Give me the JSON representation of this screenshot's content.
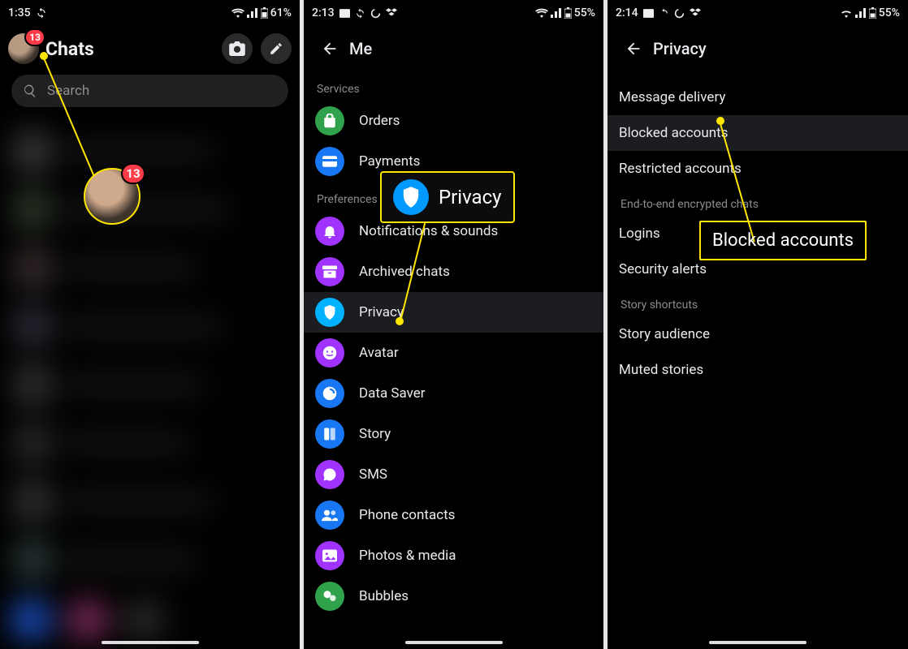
{
  "screen1": {
    "status": {
      "time": "1:35",
      "battery": "61%",
      "icons_left": [
        "sync-icon"
      ],
      "icons_right": [
        "wifi-icon",
        "signal-icon",
        "battery-icon"
      ]
    },
    "title": "Chats",
    "avatar_badge": "13",
    "big_avatar_badge": "13",
    "search_placeholder": "Search"
  },
  "screen2": {
    "status": {
      "time": "2:13",
      "battery": "55%",
      "icons_left": [
        "card-icon",
        "sync-icon",
        "spin-icon",
        "dropbox-icon"
      ]
    },
    "title": "Me",
    "sections": [
      {
        "header": "Services",
        "items": [
          {
            "icon": "bag-icon",
            "color": "c-green",
            "label": "Orders"
          },
          {
            "icon": "card-icon",
            "color": "c-blue",
            "label": "Payments"
          }
        ]
      },
      {
        "header": "Preferences",
        "items": [
          {
            "icon": "bell-icon",
            "color": "c-purp",
            "label": "Notifications & sounds"
          },
          {
            "icon": "archive-icon",
            "color": "c-purp",
            "label": "Archived chats"
          },
          {
            "icon": "shield-icon",
            "color": "c-teal",
            "label": "Privacy",
            "selected": true
          },
          {
            "icon": "face-icon",
            "color": "c-purp",
            "label": "Avatar"
          },
          {
            "icon": "data-icon",
            "color": "c-blue",
            "label": "Data Saver"
          },
          {
            "icon": "story-icon",
            "color": "c-blue",
            "label": "Story"
          },
          {
            "icon": "sms-icon",
            "color": "c-purp",
            "label": "SMS"
          },
          {
            "icon": "contacts-icon",
            "color": "c-blue",
            "label": "Phone contacts"
          },
          {
            "icon": "photos-icon",
            "color": "c-purp",
            "label": "Photos & media"
          },
          {
            "icon": "bubbles-icon",
            "color": "c-green",
            "label": "Bubbles"
          }
        ]
      }
    ],
    "callout_label": "Privacy"
  },
  "screen3": {
    "status": {
      "time": "2:14",
      "battery": "55%",
      "icons_left": [
        "card-icon",
        "sync-icon",
        "spin-icon",
        "dropbox-icon"
      ]
    },
    "title": "Privacy",
    "groups": [
      {
        "header": null,
        "items": [
          {
            "label": "Message delivery"
          },
          {
            "label": "Blocked accounts",
            "selected": true
          },
          {
            "label": "Restricted accounts"
          }
        ]
      },
      {
        "header": "End-to-end encrypted chats",
        "items": [
          {
            "label": "Logins"
          },
          {
            "label": "Security alerts"
          }
        ]
      },
      {
        "header": "Story shortcuts",
        "items": [
          {
            "label": "Story audience"
          },
          {
            "label": "Muted stories"
          }
        ]
      }
    ],
    "callout_label": "Blocked accounts"
  }
}
